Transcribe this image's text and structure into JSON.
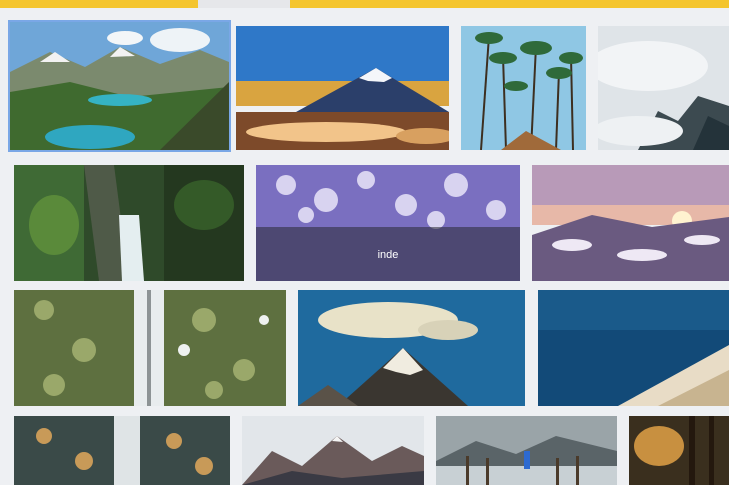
{
  "toolbar": {
    "tab_colors": {
      "accent": "#f4c52e",
      "inactive": "#e6e7ea"
    }
  },
  "gallery": {
    "selected_index": 0,
    "images": [
      {
        "subject": "alpine-lake-valley",
        "caption": ""
      },
      {
        "subject": "volcano-sunset-clouds",
        "caption": ""
      },
      {
        "subject": "palm-trees-sky",
        "caption": ""
      },
      {
        "subject": "misty-forest",
        "caption": ""
      },
      {
        "subject": "forest-waterfall",
        "caption": ""
      },
      {
        "subject": "frosted-forest-aerial",
        "caption": "inde"
      },
      {
        "subject": "snowy-hills-sunrise",
        "caption": ""
      },
      {
        "subject": "aerial-road-snowy-forest",
        "caption": ""
      },
      {
        "subject": "mountain-peak-cloud",
        "caption": ""
      },
      {
        "subject": "ocean-snow-slope",
        "caption": ""
      },
      {
        "subject": "aerial-road-autumn-forest",
        "caption": ""
      },
      {
        "subject": "misty-mountain-range",
        "caption": ""
      },
      {
        "subject": "lake-pier-person",
        "caption": ""
      },
      {
        "subject": "sunlit-forest",
        "caption": ""
      }
    ]
  }
}
